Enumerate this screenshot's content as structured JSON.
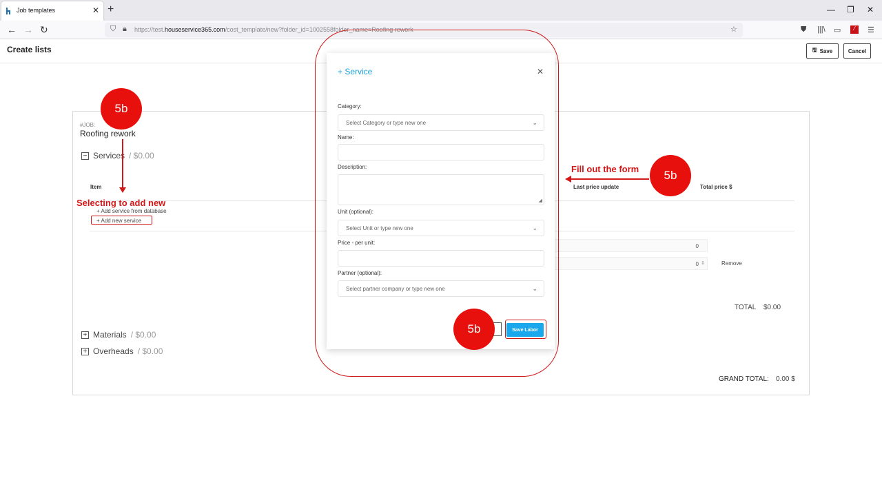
{
  "browser": {
    "tab_title": "Job templates",
    "tab_close": "✕",
    "new_tab": "+",
    "url_prefix": "https://test.",
    "url_host": "houseservice365.com",
    "url_path": "/cost_template/new?folder_id=1002558folder_name=Roofing rework",
    "icons": [
      "back-icon",
      "forward-icon",
      "reload-icon",
      "shield-icon",
      "lock-icon",
      "star-icon",
      "pocket-icon",
      "library-icon",
      "sidebar-icon",
      "extension-icon",
      "menu-icon"
    ]
  },
  "window_controls": {
    "minimize": "—",
    "restore": "❐",
    "close": "✕"
  },
  "header": {
    "title": "Create lists",
    "save_label": "Save",
    "cancel_label": "Cancel"
  },
  "job": {
    "label": "#JOB:",
    "name": "Roofing rework"
  },
  "sections": {
    "services": {
      "label": "Services",
      "amount": "/ $0.00",
      "toggle": "−"
    },
    "materials": {
      "label": "Materials",
      "amount": "/ $0.00",
      "toggle": "+"
    },
    "overheads": {
      "label": "Overheads",
      "amount": "/ $0.00",
      "toggle": "+"
    }
  },
  "table": {
    "col_item": "Item",
    "col_last_update": "Last price update",
    "col_total": "Total price $",
    "add_from_db": "+ Add service from database",
    "add_new": "+ Add new service",
    "field_value_1": "0",
    "field_value_2": "0",
    "remove": "Remove",
    "total_label": "TOTAL",
    "total_value": "$0.00",
    "grand_total_label": "GRAND TOTAL:",
    "grand_total_value": "0.00 $"
  },
  "modal": {
    "title": "+ Service",
    "close": "✕",
    "category_label": "Category:",
    "category_placeholder": "Select Category or type new one",
    "name_label": "Name:",
    "description_label": "Description:",
    "unit_label": "Unit (optional):",
    "unit_placeholder": "Select Unit or type new one",
    "price_label": "Price - per unit:",
    "partner_label": "Partner (optional):",
    "partner_placeholder": "Select partner company or type new one",
    "save_label": "Save Labor"
  },
  "annotations": {
    "badge": "5b",
    "selecting_text": "Selecting to add new",
    "fill_text": "Fill out the form",
    "accent_color": "#d01818",
    "badge_color": "#e8100c"
  },
  "colors": {
    "modal_accent": "#1aa0dd",
    "save_button": "#1aa7ec"
  }
}
